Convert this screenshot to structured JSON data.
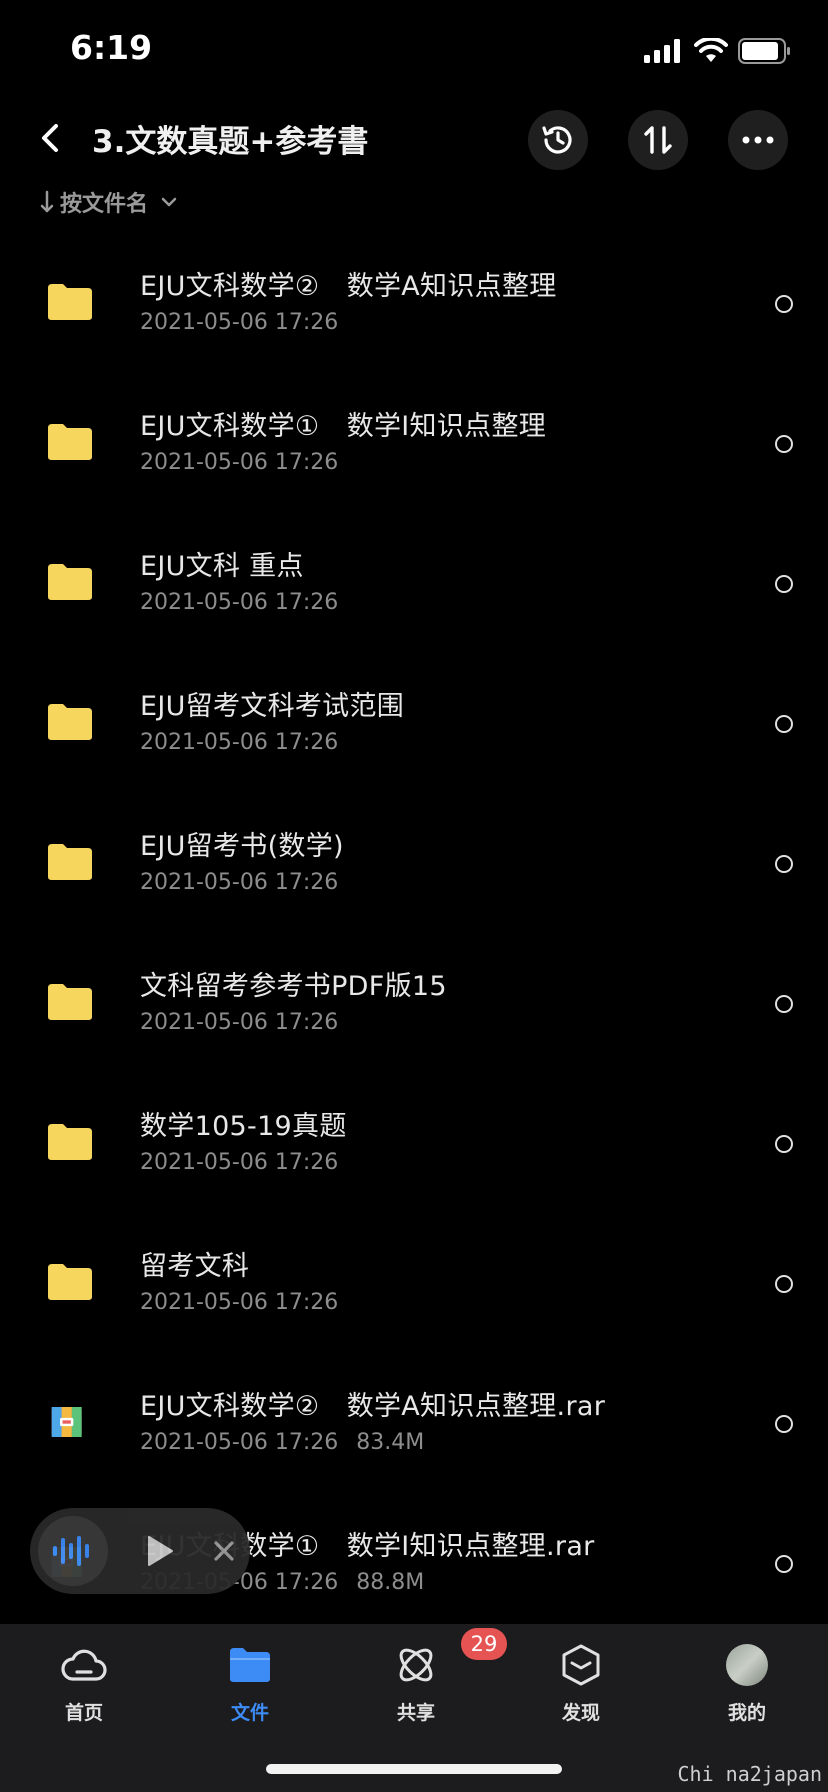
{
  "status_bar": {
    "time": "6:19"
  },
  "header": {
    "title": "3.文数真题+参考書",
    "sort_label": "按文件名"
  },
  "files": [
    {
      "name": "EJU文科数学②　数学A知识点整理",
      "date": "2021-05-06 17:26",
      "size": "",
      "type": "folder"
    },
    {
      "name": "EJU文科数学①　数学I知识点整理",
      "date": "2021-05-06 17:26",
      "size": "",
      "type": "folder"
    },
    {
      "name": "EJU文科 重点",
      "date": "2021-05-06 17:26",
      "size": "",
      "type": "folder"
    },
    {
      "name": "EJU留考文科考试范围",
      "date": "2021-05-06 17:26",
      "size": "",
      "type": "folder"
    },
    {
      "name": "EJU留考书(数学)",
      "date": "2021-05-06 17:26",
      "size": "",
      "type": "folder"
    },
    {
      "name": "文科留考参考书PDF版15",
      "date": "2021-05-06 17:26",
      "size": "",
      "type": "folder"
    },
    {
      "name": "数学105-19真题",
      "date": "2021-05-06 17:26",
      "size": "",
      "type": "folder"
    },
    {
      "name": "留考文科",
      "date": "2021-05-06 17:26",
      "size": "",
      "type": "folder"
    },
    {
      "name": "EJU文科数学②　数学A知识点整理.rar",
      "date": "2021-05-06 17:26",
      "size": "83.4M",
      "type": "archive"
    },
    {
      "name": "EJU文科数学①　数学I知识点整理.rar",
      "date": "2021-05-06 17:26",
      "size": "88.8M",
      "type": "archive"
    }
  ],
  "tab_bar": {
    "tabs": [
      {
        "label": "首页",
        "icon": "cloud-icon"
      },
      {
        "label": "文件",
        "icon": "folder-icon"
      },
      {
        "label": "共享",
        "icon": "share-icon",
        "badge": "29"
      },
      {
        "label": "发现",
        "icon": "discover-icon"
      },
      {
        "label": "我的",
        "icon": "avatar"
      }
    ]
  },
  "watermark": "Chi na2japan",
  "colors": {
    "accent": "#3d8bf5",
    "folder": "#f7d65e",
    "badge": "#e55353"
  }
}
